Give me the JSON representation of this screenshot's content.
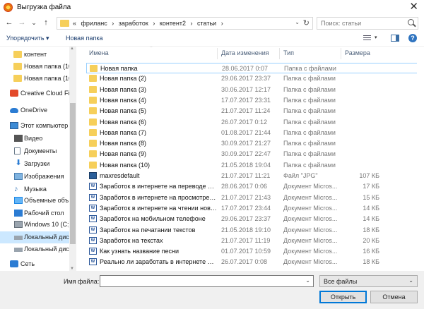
{
  "window": {
    "title": "Выгрузка файла",
    "close_glyph": "✕"
  },
  "nav": {
    "back": "←",
    "forward": "→",
    "dropdown": "⌄",
    "up": "↑",
    "path": [
      "«",
      "фриланс",
      "›",
      "заработок",
      "›",
      "контент2",
      "›",
      "статьи",
      "›"
    ],
    "addr_dropdown": "⌄",
    "refresh": "↻",
    "search_placeholder": "Поиск: статьи"
  },
  "toolbar": {
    "organize": "Упорядочить ▾",
    "new_folder": "Новая папка",
    "view_dropdown": "▾",
    "help": "?"
  },
  "sidebar": {
    "items": [
      {
        "label": "контент",
        "icon": "folder-icon"
      },
      {
        "label": "Новая папка (10",
        "icon": "folder-icon"
      },
      {
        "label": "Новая папка (16",
        "icon": "folder-icon"
      },
      {
        "label": "Creative Cloud Fil",
        "icon": "creative-cloud-icon"
      },
      {
        "label": "OneDrive",
        "icon": "onedrive-icon"
      },
      {
        "label": "Этот компьютер",
        "icon": "computer-icon"
      },
      {
        "label": "Видео",
        "icon": "video-icon"
      },
      {
        "label": "Документы",
        "icon": "documents-icon"
      },
      {
        "label": "Загрузки",
        "icon": "downloads-icon"
      },
      {
        "label": "Изображения",
        "icon": "images-icon"
      },
      {
        "label": "Музыка",
        "icon": "music-icon"
      },
      {
        "label": "Объемные объ",
        "icon": "3d-objects-icon"
      },
      {
        "label": "Рабочий стол",
        "icon": "desktop-icon"
      },
      {
        "label": "Windows 10 (C:)",
        "icon": "windows-drive-icon"
      },
      {
        "label": "Локальный дис",
        "icon": "drive-icon"
      },
      {
        "label": "Локальный дис",
        "icon": "drive-icon"
      },
      {
        "label": "Сеть",
        "icon": "network-icon"
      }
    ],
    "glyph_down": "⬇",
    "glyph_music": "♪",
    "scroll_up": "▲",
    "scroll_down": "▼"
  },
  "columns": {
    "name": "Имена",
    "date": "Дата изменения",
    "type": "Тип",
    "size": "Размера",
    "sort_glyph": "^"
  },
  "files": [
    {
      "name": "Новая папка",
      "date": "28.06.2017 0:07",
      "type": "Папка с файлами",
      "size": "",
      "icon": "folder"
    },
    {
      "name": "Новая папка (2)",
      "date": "29.06.2017 23:37",
      "type": "Папка с файлами",
      "size": "",
      "icon": "folder"
    },
    {
      "name": "Новая папка (3)",
      "date": "30.06.2017 12:17",
      "type": "Папка с файлами",
      "size": "",
      "icon": "folder"
    },
    {
      "name": "Новая папка (4)",
      "date": "17.07.2017 23:31",
      "type": "Папка с файлами",
      "size": "",
      "icon": "folder"
    },
    {
      "name": "Новая папка (5)",
      "date": "21.07.2017 11:24",
      "type": "Папка с файлами",
      "size": "",
      "icon": "folder"
    },
    {
      "name": "Новая папка (6)",
      "date": "26.07.2017 0:12",
      "type": "Папка с файлами",
      "size": "",
      "icon": "folder"
    },
    {
      "name": "Новая папка (7)",
      "date": "01.08.2017 21:44",
      "type": "Папка с файлами",
      "size": "",
      "icon": "folder"
    },
    {
      "name": "Новая папка (8)",
      "date": "30.09.2017 21:27",
      "type": "Папка с файлами",
      "size": "",
      "icon": "folder"
    },
    {
      "name": "Новая папка (9)",
      "date": "30.09.2017 22:47",
      "type": "Папка с файлами",
      "size": "",
      "icon": "folder"
    },
    {
      "name": "Новая папка (10)",
      "date": "21.05.2018 19:04",
      "type": "Папка с файлами",
      "size": "",
      "icon": "folder"
    },
    {
      "name": "maxresdefault",
      "date": "21.07.2017 11:21",
      "type": "Файл \"JPG\"",
      "size": "107 КБ",
      "icon": "jpg"
    },
    {
      "name": "Заработок в интернете на переводе текс...",
      "date": "28.06.2017 0:06",
      "type": "Документ Micros...",
      "size": "17 КБ",
      "icon": "word"
    },
    {
      "name": "Заработок в интернете на просмотре в...",
      "date": "21.07.2017 21:43",
      "type": "Документ Micros...",
      "size": "15 КБ",
      "icon": "word"
    },
    {
      "name": "Заработок в интернете на чтении ново...",
      "date": "17.07.2017 23:44",
      "type": "Документ Micros...",
      "size": "14 КБ",
      "icon": "word"
    },
    {
      "name": "Заработок на мобильном телефоне",
      "date": "29.06.2017 23:37",
      "type": "Документ Micros...",
      "size": "14 КБ",
      "icon": "word"
    },
    {
      "name": "Заработок на печатании текстов",
      "date": "21.05.2018 19:10",
      "type": "Документ Micros...",
      "size": "18 КБ",
      "icon": "word"
    },
    {
      "name": "Заработок на текстах",
      "date": "21.07.2017 11:19",
      "type": "Документ Micros...",
      "size": "20 КБ",
      "icon": "word"
    },
    {
      "name": "Как узнать название песни",
      "date": "01.07.2017 10:59",
      "type": "Документ Micros...",
      "size": "16 КБ",
      "icon": "word"
    },
    {
      "name": "Реально ли заработать в интернете на ...",
      "date": "26.07.2017 0:08",
      "type": "Документ Micros...",
      "size": "18 КБ",
      "icon": "word"
    }
  ],
  "word_glyph": "W",
  "footer": {
    "filename_label": "Имя файла:",
    "filename_value": "",
    "dropdown_glyph": "⌄",
    "filetype": "Все файлы",
    "open": "Открыть",
    "cancel": "Отмена"
  }
}
